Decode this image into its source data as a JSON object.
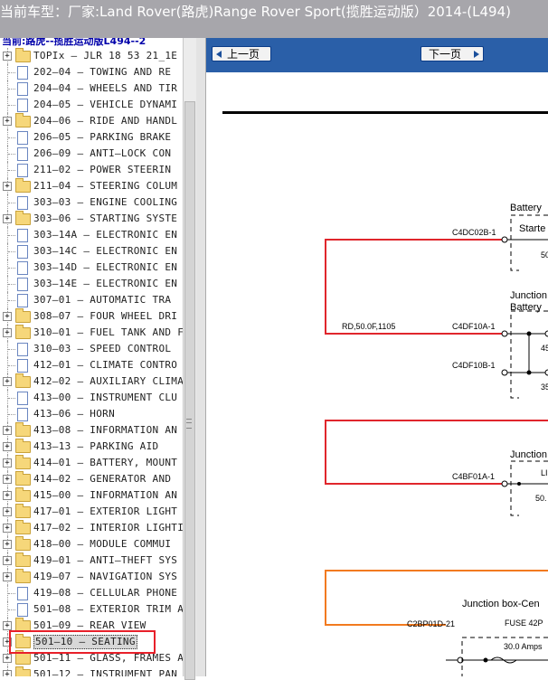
{
  "window": {
    "title": "当前车型：厂家:Land Rover(路虎)Range Rover Sport(揽胜运动版）2014-(L494)"
  },
  "tree": {
    "root_label": "当前:路虎--揽胜运动版L494--2",
    "items": [
      {
        "label": "TOPIx — JLR 18 53 21_1E —",
        "kind": "folder",
        "expandable": true
      },
      {
        "label": "202—04 — TOWING AND RE",
        "kind": "doc",
        "expandable": false
      },
      {
        "label": "204—04 — WHEELS AND TIR",
        "kind": "doc",
        "expandable": false
      },
      {
        "label": "204—05 — VEHICLE DYNAMI",
        "kind": "doc",
        "expandable": false
      },
      {
        "label": "204—06 — RIDE AND HANDL",
        "kind": "folder",
        "expandable": true
      },
      {
        "label": "206—05 — PARKING BRAKE",
        "kind": "doc",
        "expandable": false
      },
      {
        "label": "206—09 — ANTI—LOCK CON",
        "kind": "doc",
        "expandable": false
      },
      {
        "label": "211—02 — POWER STEERIN",
        "kind": "doc",
        "expandable": false
      },
      {
        "label": "211—04 — STEERING COLUM",
        "kind": "folder",
        "expandable": true
      },
      {
        "label": "303—03 — ENGINE COOLING",
        "kind": "doc",
        "expandable": false
      },
      {
        "label": "303—06 — STARTING SYSTE",
        "kind": "folder",
        "expandable": true
      },
      {
        "label": "303—14A — ELECTRONIC EN",
        "kind": "doc",
        "expandable": false
      },
      {
        "label": "303—14C — ELECTRONIC EN",
        "kind": "doc",
        "expandable": false
      },
      {
        "label": "303—14D — ELECTRONIC EN",
        "kind": "doc",
        "expandable": false
      },
      {
        "label": "303—14E — ELECTRONIC EN",
        "kind": "doc",
        "expandable": false
      },
      {
        "label": "307—01 — AUTOMATIC TRA",
        "kind": "doc",
        "expandable": false
      },
      {
        "label": "308—07 — FOUR WHEEL DRI",
        "kind": "folder",
        "expandable": true
      },
      {
        "label": "310—01 — FUEL TANK AND F",
        "kind": "folder",
        "expandable": true
      },
      {
        "label": "310—03 — SPEED CONTROL",
        "kind": "doc",
        "expandable": false
      },
      {
        "label": "412—01 — CLIMATE CONTRO",
        "kind": "doc",
        "expandable": false
      },
      {
        "label": "412—02 — AUXILIARY CLIMA",
        "kind": "folder",
        "expandable": true
      },
      {
        "label": "413—00 — INSTRUMENT CLU",
        "kind": "doc",
        "expandable": false
      },
      {
        "label": "413—06 — HORN",
        "kind": "doc",
        "expandable": false
      },
      {
        "label": "413—08 — INFORMATION AN",
        "kind": "folder",
        "expandable": true
      },
      {
        "label": "413—13 — PARKING AID",
        "kind": "folder",
        "expandable": true
      },
      {
        "label": "414—01 — BATTERY, MOUNT",
        "kind": "folder",
        "expandable": true
      },
      {
        "label": "414—02 — GENERATOR AND",
        "kind": "folder",
        "expandable": true
      },
      {
        "label": "415—00 — INFORMATION AN",
        "kind": "folder",
        "expandable": true
      },
      {
        "label": "417—01 — EXTERIOR LIGHT",
        "kind": "folder",
        "expandable": true
      },
      {
        "label": "417—02 — INTERIOR LIGHTI",
        "kind": "folder",
        "expandable": true
      },
      {
        "label": "418—00 — MODULE COMMUI",
        "kind": "folder",
        "expandable": true
      },
      {
        "label": "419—01 — ANTI—THEFT SYS",
        "kind": "folder",
        "expandable": true
      },
      {
        "label": "419—07 — NAVIGATION SYS",
        "kind": "folder",
        "expandable": true
      },
      {
        "label": "419—08 — CELLULAR PHONE",
        "kind": "doc",
        "expandable": false
      },
      {
        "label": "501—08 — EXTERIOR TRIM A",
        "kind": "doc",
        "expandable": false
      },
      {
        "label": "501—09 — REAR VIEW",
        "kind": "folder",
        "expandable": true
      },
      {
        "label": "501—10 — SEATING",
        "kind": "folder",
        "expandable": true,
        "selected": true
      },
      {
        "label": "501—11 — GLASS, FRAMES A",
        "kind": "folder",
        "expandable": true
      },
      {
        "label": "501—12 — INSTRUMENT PAN",
        "kind": "folder",
        "expandable": true
      }
    ]
  },
  "viewer": {
    "prev_label": "上一页",
    "next_label": "下一页"
  },
  "diagram": {
    "labels": {
      "battery": "Battery",
      "starter": "Starte",
      "junction1": "Junction",
      "battery2": "Battery",
      "junction2": "Junction",
      "junction_box": "Junction box-Cen",
      "fuse": "FUSE 42P",
      "amps": "30.0 Amps",
      "c4dc02b": "C4DC02B-1",
      "wire_spec": "RD,50.0F,1105",
      "c4df10a": "C4DF10A-1",
      "c4df10b": "C4DF10B-1",
      "c4bf01a": "C4BF01A-1",
      "c2bp01d": "C2BP01D-21",
      "n50a": "50",
      "n45": "45",
      "n35": "35",
      "n50b": "50.",
      "li": "LI"
    },
    "colors": {
      "red": "#e0262c",
      "orange": "#f27a1f",
      "accent_blue": "#2a5fa8"
    }
  }
}
